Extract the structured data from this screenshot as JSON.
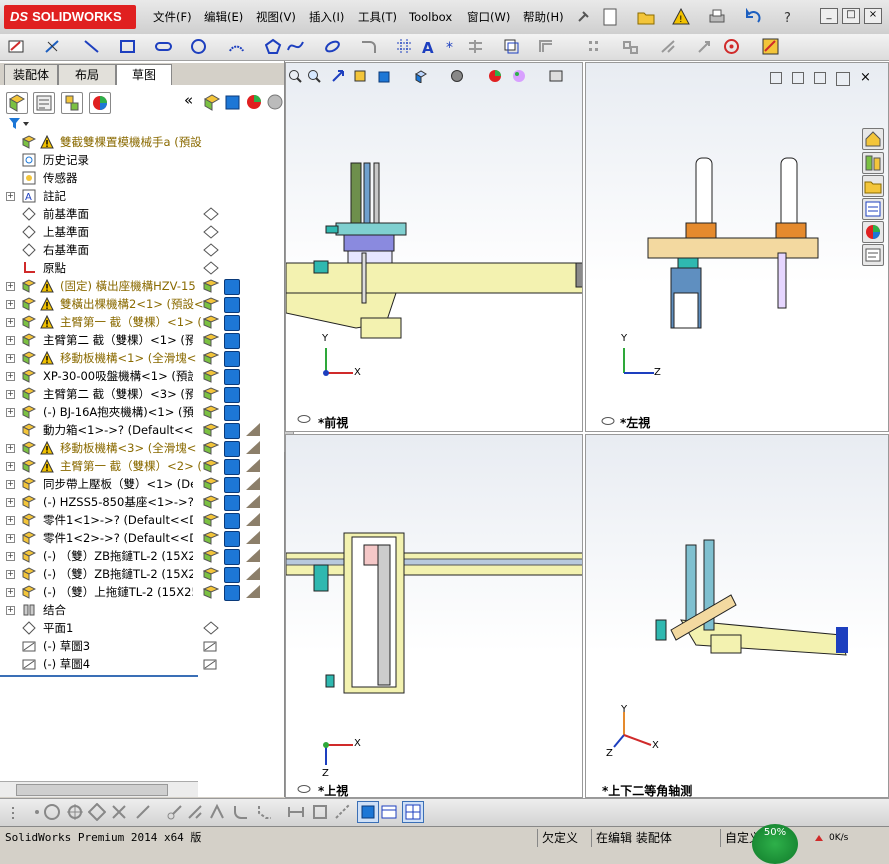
{
  "app": {
    "brand": "SOLIDWORKS",
    "brand_prefix": "DS",
    "menu": [
      "文件(F)",
      "编辑(E)",
      "视图(V)",
      "插入(I)",
      "工具(T)",
      "Toolbox",
      "窗口(W)",
      "帮助(H)"
    ],
    "win_buttons": [
      "_",
      "□",
      "×"
    ]
  },
  "tabs": [
    "装配体",
    "布局",
    "草图"
  ],
  "active_tab": "草图",
  "collapse_glyph": "«",
  "tree": [
    {
      "label": "雙截雙棵置模機械手a  (預設",
      "warn": true,
      "exp": "",
      "color": "#8a6a00",
      "icon": "assembly-icon"
    },
    {
      "label": "历史记录",
      "exp": "",
      "icon": "history-icon"
    },
    {
      "label": "传感器",
      "exp": "",
      "icon": "sensor-icon"
    },
    {
      "label": "註記",
      "exp": "+",
      "icon": "annotation-icon"
    },
    {
      "label": "前基準面",
      "exp": "",
      "icon": "plane-icon"
    },
    {
      "label": "上基準面",
      "exp": "",
      "icon": "plane-icon"
    },
    {
      "label": "右基準面",
      "exp": "",
      "icon": "plane-icon"
    },
    {
      "label": "原點",
      "exp": "",
      "icon": "origin-icon"
    },
    {
      "label": "(固定) 橫出座機構HZV-15",
      "warn": true,
      "exp": "+",
      "color": "#8a6a00",
      "icon": "subassembly-icon"
    },
    {
      "label": "雙橫出棵機構2<1> (預設<",
      "warn": true,
      "exp": "+",
      "color": "#8a6a00",
      "icon": "subassembly-icon"
    },
    {
      "label": "主臂第一 截（雙棵）<1> (",
      "warn": true,
      "exp": "+",
      "color": "#8a6a00",
      "icon": "subassembly-icon"
    },
    {
      "label": "主臂第二 截（雙棵）<1> (預",
      "exp": "+",
      "icon": "subassembly-icon"
    },
    {
      "label": "移動板機構<1> (全滑塊<",
      "warn": true,
      "exp": "+",
      "color": "#8a6a00",
      "icon": "subassembly-icon"
    },
    {
      "label": "XP-30-00吸盤機構<1> (預設<",
      "exp": "+",
      "icon": "subassembly-icon"
    },
    {
      "label": "主臂第二 截（雙棵）<3> (預",
      "exp": "+",
      "icon": "subassembly-icon"
    },
    {
      "label": "(-) BJ-16A抱夾機構)<1> (預",
      "exp": "+",
      "icon": "subassembly-icon"
    },
    {
      "label": "動力箱<1>->? (Default<<Def",
      "exp": "",
      "icon": "part-icon"
    },
    {
      "label": "移動板機構<3> (全滑塊<",
      "warn": true,
      "exp": "+",
      "color": "#8a6a00",
      "icon": "subassembly-icon"
    },
    {
      "label": "主臂第一 截（雙棵）<2> (",
      "warn": true,
      "exp": "+",
      "color": "#8a6a00",
      "icon": "subassembly-icon"
    },
    {
      "label": "同步帶上壓板（雙）<1> (Def",
      "exp": "+",
      "icon": "part-icon"
    },
    {
      "label": "(-) HZSS5-850基座<1>->? (I",
      "exp": "+",
      "icon": "part-icon"
    },
    {
      "label": "零件1<1>->? (Default<<Defa",
      "exp": "+",
      "icon": "part-icon"
    },
    {
      "label": "零件1<2>->? (Default<<Defa",
      "exp": "+",
      "icon": "part-icon"
    },
    {
      "label": "(-) （雙）ZB拖鏈TL-2 (15X25",
      "exp": "+",
      "icon": "part-icon"
    },
    {
      "label": "(-) （雙）ZB拖鏈TL-2 (15X25",
      "exp": "+",
      "icon": "part-icon"
    },
    {
      "label": "(-) （雙）上拖鏈TL-2 (15X25",
      "exp": "+",
      "icon": "part-icon"
    },
    {
      "label": "结合",
      "exp": "+",
      "icon": "mates-icon"
    },
    {
      "label": "平面1",
      "exp": "",
      "icon": "plane-icon"
    },
    {
      "label": "(-) 草圖3",
      "exp": "",
      "icon": "sketch-icon"
    },
    {
      "label": "(-) 草圖4",
      "exp": "",
      "icon": "sketch-icon"
    }
  ],
  "viewports": [
    {
      "label": "*前視"
    },
    {
      "label": "*左視"
    },
    {
      "label": "*上視"
    },
    {
      "label": "*上下二等角轴测"
    }
  ],
  "axes": {
    "x": "X",
    "y": "Y",
    "z": "Z"
  },
  "status": {
    "version": "SolidWorks Premium 2014 x64 版",
    "state1": "欠定义",
    "state2": "在编辑 装配体",
    "state3": "自定义",
    "gauge": "50%",
    "net": "0K/s"
  },
  "colors": {
    "accent": "#1d77d6",
    "warning": "#f2c200",
    "brand": "#e02020"
  }
}
